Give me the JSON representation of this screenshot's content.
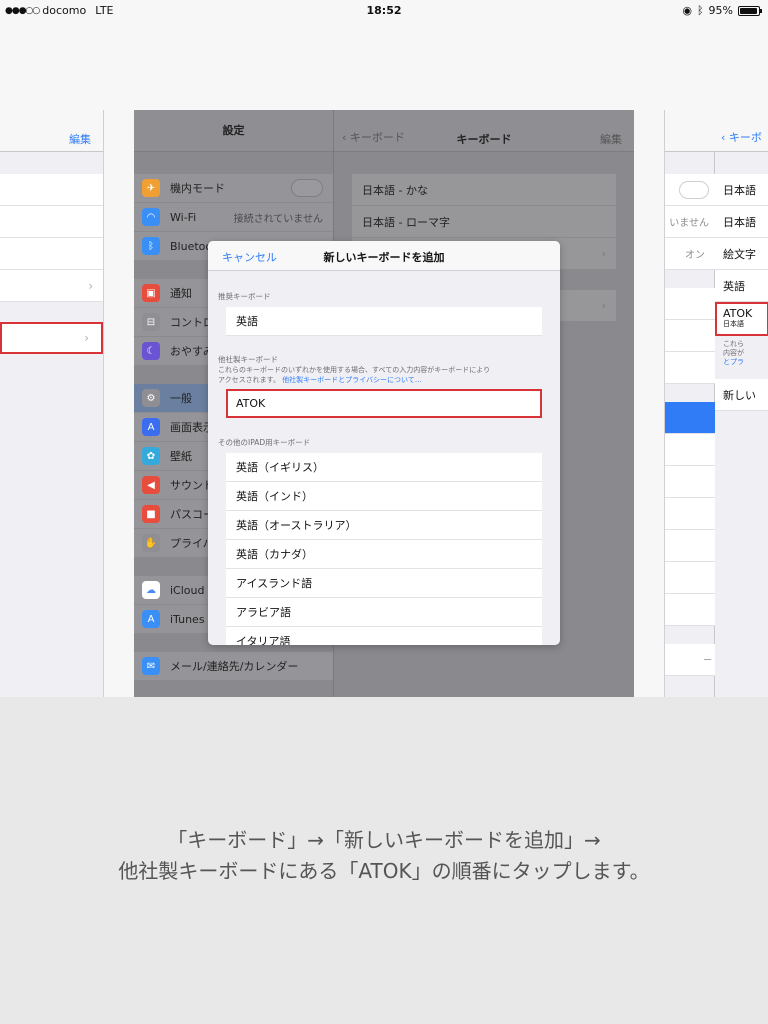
{
  "status_bar": {
    "carrier": "docomo",
    "network": "LTE",
    "time": "18:52",
    "battery": "95%",
    "battery_level": 0.95
  },
  "left_panel": {
    "edit": "編集"
  },
  "center_panel": {
    "settings_title": "設定",
    "items": [
      {
        "label": "機内モード",
        "icon": "airplane-icon",
        "color": "#f0a032"
      },
      {
        "label": "Wi-Fi",
        "icon": "wifi-icon",
        "color": "#3a8ff7"
      },
      {
        "label": "Bluetooth",
        "icon": "bluetooth-icon",
        "color": "#3a8ff7"
      },
      {
        "label": "通知",
        "icon": "notification-icon",
        "color": "#e74c3c"
      },
      {
        "label": "コントロールセンター",
        "icon": "control-center-icon",
        "color": "#8e8e93"
      },
      {
        "label": "おやすみモード",
        "icon": "moon-icon",
        "color": "#6b54d3"
      },
      {
        "label": "一般",
        "icon": "gear-icon",
        "color": "#8e8e93"
      },
      {
        "label": "画面表示と明るさ",
        "icon": "display-icon",
        "color": "#3a6df0"
      },
      {
        "label": "壁紙",
        "icon": "wallpaper-icon",
        "color": "#34aadc"
      },
      {
        "label": "サウンド",
        "icon": "sound-icon",
        "color": "#e74c3c"
      },
      {
        "label": "パスコード",
        "icon": "lock-icon",
        "color": "#e74c3c"
      },
      {
        "label": "プライバシー",
        "icon": "hand-icon",
        "color": "#8e8e93"
      },
      {
        "label": "iCloud",
        "icon": "cloud-icon",
        "color": "#ffffff"
      },
      {
        "label": "iTunes & App Store",
        "icon": "appstore-icon",
        "color": "#3a8ff7"
      },
      {
        "label": "メール/連絡先/カレンダー",
        "icon": "mail-icon",
        "color": "#3a8ff7"
      }
    ],
    "wifi_value": "接続されていません",
    "detail_back": "キーボード",
    "detail_title": "キーボード",
    "detail_edit": "編集",
    "keyboards": [
      "日本語 - かな",
      "日本語 - ローマ字"
    ]
  },
  "modal": {
    "cancel": "キャンセル",
    "title": "新しいキーボードを追加",
    "suggested_header": "推奨キーボード",
    "suggested": [
      "英語"
    ],
    "third_party_header": "他社製キーボード",
    "third_party_note": "これらのキーボードのいずれかを使用する場合、すべての入力内容がキーボードにより",
    "third_party_note2": "アクセスされます。",
    "privacy_link": "他社製キーボードとプライバシーについて…",
    "third_party": [
      "ATOK"
    ],
    "other_header": "その他のIPAD用キーボード",
    "other": [
      "英語（イギリス）",
      "英語（インド）",
      "英語（オーストラリア）",
      "英語（カナダ）",
      "アイスランド語",
      "アラビア語",
      "イタリア語"
    ]
  },
  "right_panel": {
    "back": "キーボ",
    "wifi_value": "いません",
    "bluetooth_value": "オン",
    "keyboards": [
      "日本語",
      "日本語",
      "絵文字",
      "英語"
    ],
    "atok": "ATOK",
    "atok_sub": "日本語",
    "note1": "これら",
    "note2": "内容が",
    "note3": "とプラ",
    "add": "新しい",
    "footer": "ー"
  },
  "caption": {
    "line1": "「キーボード」→「新しいキーボードを追加」→",
    "line2": "他社製キーボードにある「ATOK」の順番にタップします。"
  }
}
